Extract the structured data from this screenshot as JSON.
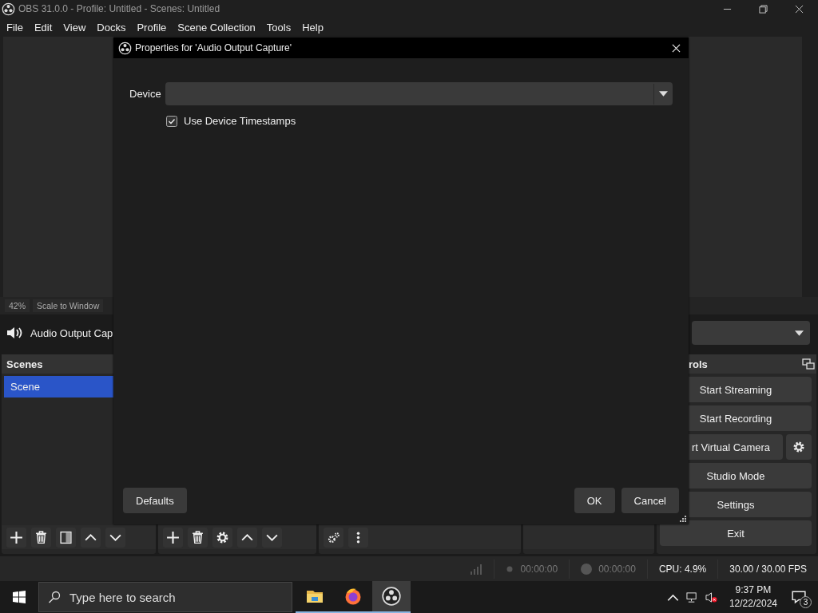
{
  "window": {
    "title": "OBS 31.0.0 - Profile: Untitled - Scenes: Untitled"
  },
  "menu": [
    "File",
    "Edit",
    "View",
    "Docks",
    "Profile",
    "Scene Collection",
    "Tools",
    "Help"
  ],
  "preview": {
    "zoom": "42%",
    "scale_mode": "Scale to Window"
  },
  "source_bar": {
    "source": "Audio Output Cap"
  },
  "scenes": {
    "title": "Scenes",
    "items": [
      {
        "label": "Scene",
        "selected": true
      }
    ]
  },
  "controls": {
    "title": "rols",
    "buttons": [
      {
        "label": "Start Streaming",
        "kind": "plain"
      },
      {
        "label": "Start Recording",
        "kind": "plain"
      },
      {
        "label": "rt Virtual Camera",
        "kind": "with_settings"
      },
      {
        "label": "Studio Mode",
        "kind": "plain"
      },
      {
        "label": "Settings",
        "kind": "plain"
      },
      {
        "label": "Exit",
        "kind": "plain"
      }
    ]
  },
  "status_bar": {
    "stream_time": "00:00:00",
    "record_time": "00:00:00",
    "cpu": "CPU: 4.9%",
    "fps": "30.00 / 30.00 FPS"
  },
  "dialog": {
    "title": "Properties for 'Audio Output Capture'",
    "device_label": "Device",
    "timestamps": {
      "label": "Use Device Timestamps",
      "checked": true
    },
    "defaults": "Defaults",
    "ok": "OK",
    "cancel": "Cancel"
  },
  "taskbar": {
    "search": {
      "placeholder": "Type here to search"
    },
    "apps": [
      {
        "kind": "explorer",
        "selected": false
      },
      {
        "kind": "firefox",
        "selected": false
      },
      {
        "kind": "obs",
        "selected": true
      }
    ],
    "time": "9:37 PM",
    "date": "12/22/2024",
    "notifications": "3"
  }
}
